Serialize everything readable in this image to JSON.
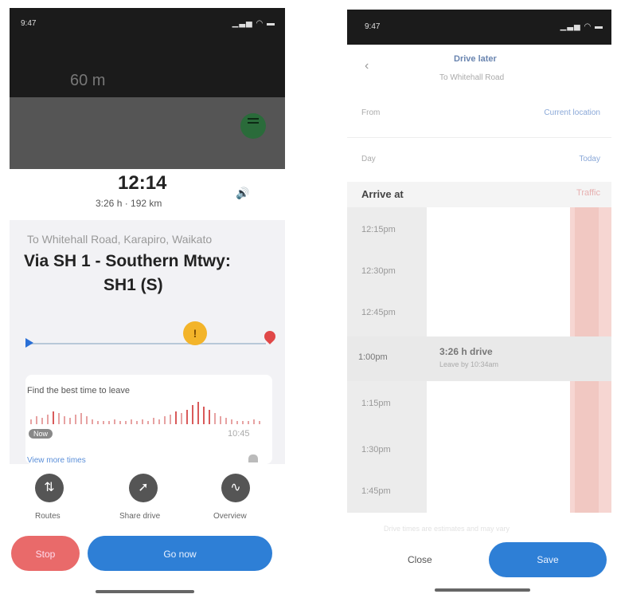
{
  "left_phone": {
    "status_time": "9:47",
    "status_signals": "▁▃▅ ◠ ▬",
    "distance": "60 m",
    "eta_time": "12:14",
    "eta_sub": "3:26 h · 192 km",
    "volume_icon": "speaker-icon",
    "destination": "To Whitehall Road, Karapiro, Waikato",
    "route_line1": "Via SH 1 - Southern Mtwy:",
    "route_line2": "SH1 (S)",
    "best_time_title": "Find the best time to leave",
    "now_badge": "Now",
    "leave_time": "10:45",
    "more_link": "View more times",
    "actions": [
      {
        "label": "Routes",
        "icon": "routes-icon",
        "glyph": "⇅"
      },
      {
        "label": "Share drive",
        "icon": "share-drive-icon",
        "glyph": "➚"
      },
      {
        "label": "Overview",
        "icon": "overview-icon",
        "glyph": "∿"
      }
    ],
    "stop_label": "Stop",
    "go_label": "Go now",
    "traffic_bars": [
      3,
      5,
      4,
      6,
      8,
      7,
      5,
      4,
      6,
      7,
      5,
      3,
      2,
      2,
      2,
      3,
      2,
      2,
      3,
      2,
      3,
      2,
      4,
      3,
      5,
      6,
      8,
      7,
      9,
      12,
      14,
      11,
      9,
      7,
      5,
      4,
      3,
      2,
      2,
      2,
      3,
      2
    ]
  },
  "right_phone": {
    "status_time": "9:47",
    "status_signals": "▁▃▅ ◠ ▬",
    "back_glyph": "‹",
    "title": "Drive later",
    "subtitle": "To Whitehall Road",
    "from_label": "From",
    "from_value": "Current location",
    "day_label": "Day",
    "day_value": "Today",
    "arrive_label": "Arrive at",
    "traffic_label": "Traffic",
    "times": [
      "12:15pm",
      "12:30pm",
      "12:45pm",
      "1:00pm",
      "1:15pm",
      "1:30pm",
      "1:45pm"
    ],
    "selected_drive": "3:26 h drive",
    "selected_leave": "Leave by 10:34am",
    "note": "Drive times are estimates and may vary",
    "close_label": "Close",
    "save_label": "Save"
  }
}
